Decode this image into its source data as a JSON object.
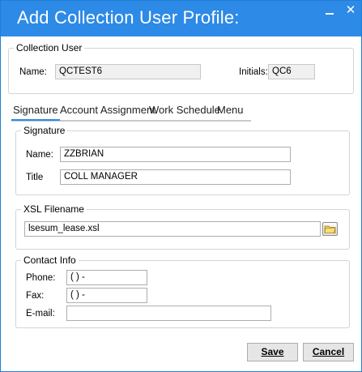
{
  "window": {
    "title": "Add Collection User Profile:"
  },
  "collection_user": {
    "legend": "Collection User",
    "name_label": "Name:",
    "name_value": "QCTEST6",
    "initials_label": "Initials:",
    "initials_value": "QC6"
  },
  "tabs": [
    {
      "label": "Signature",
      "active": true
    },
    {
      "label": "Account Assignment",
      "active": false
    },
    {
      "label": "Work Schedule",
      "active": false
    },
    {
      "label": "Menu",
      "active": false
    }
  ],
  "signature": {
    "legend": "Signature",
    "name_label": "Name:",
    "name_value": "ZZBRIAN",
    "title_label": "Title",
    "title_value": "COLL MANAGER"
  },
  "xsl": {
    "legend": "XSL Filename",
    "filename": "lsesum_lease.xsl",
    "browse_icon": "folder-icon"
  },
  "contact": {
    "legend": "Contact Info",
    "phone_label": "Phone:",
    "phone_value": "(   )    -",
    "fax_label": "Fax:",
    "fax_value": "(   )    -",
    "email_label": "E-mail:",
    "email_value": ""
  },
  "buttons": {
    "save": "Save",
    "cancel": "Cancel"
  },
  "colors": {
    "titlebar": "#2d8ae6",
    "accent": "#2d8ae6"
  }
}
